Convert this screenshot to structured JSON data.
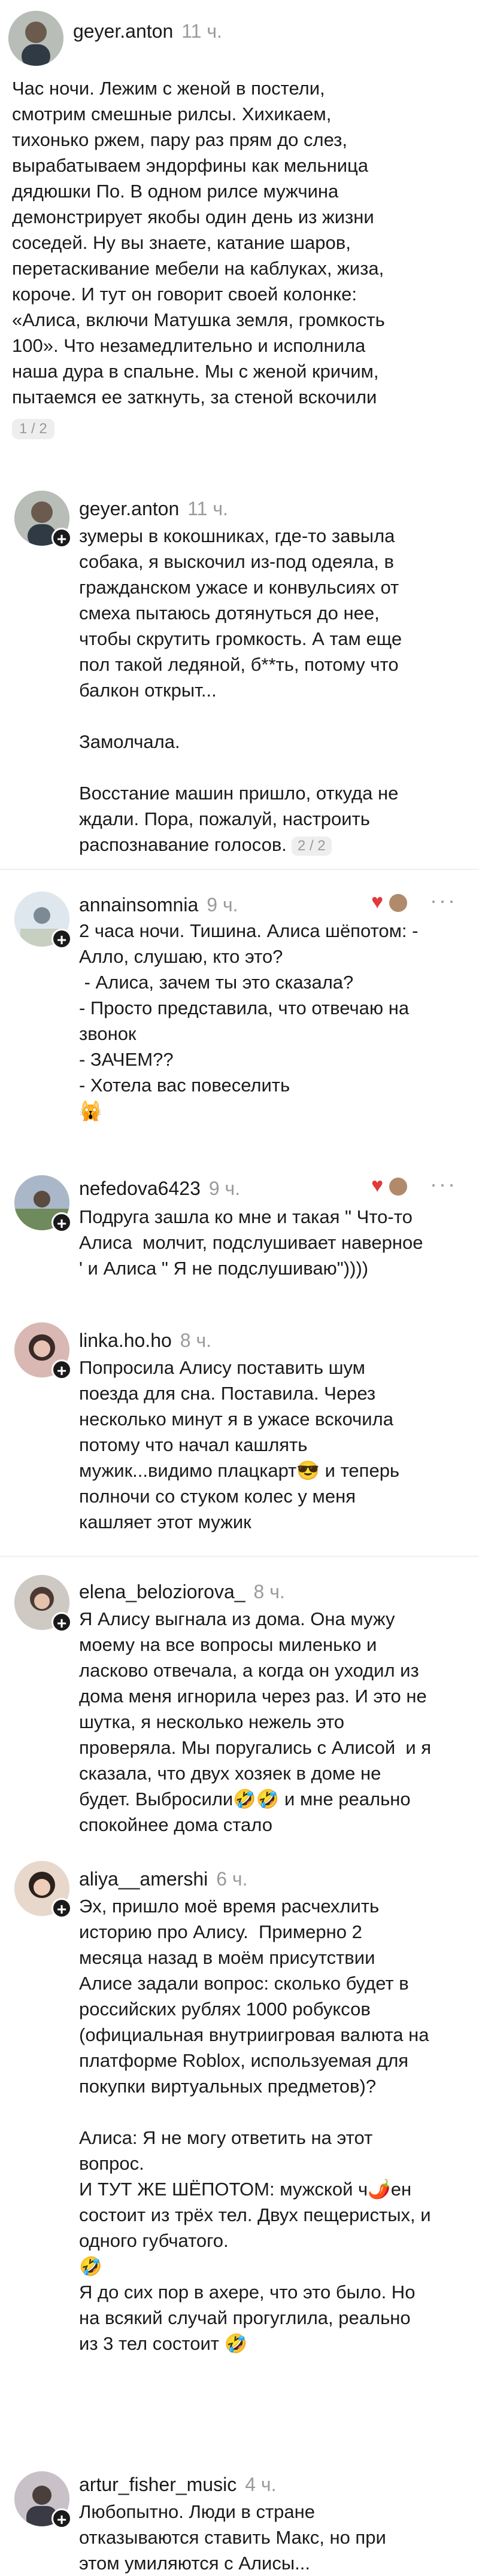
{
  "comments": [
    {
      "username": "geyer.anton",
      "time": "11 ч.",
      "text": "Час ночи. Лежим с женой в постели,\nсмотрим смешные рилсы. Хихикаем,\nтихонько ржем, пару раз прям до слез,\nвырабатываем эндорфины как мельница\nдядюшки По. В одном рилсе мужчина\nдемонстрирует якобы один день из жизни\nсоседей. Ну вы знаете, катание шаров,\nперетаскивание мебели на каблуках, жиза,\nкороче. И тут он говорит своей колонке:\n«Алиса, включи Матушка земля, громкость\n100». Что незамедлительно и исполнила\nнаша дура в спальне. Мы с женой кричим,\nпытаемся ее заткнуть, за стеной вскочили",
      "pager": "1 / 2"
    },
    {
      "username": "geyer.anton",
      "time": "11 ч.",
      "text": "зумеры в кокошниках, где-то завыла\nсобака, я выскочил из-под одеяла, в\nгражданском ужасе и конвульсиях от\nсмеха пытаюсь дотянуться до нее,\nчтобы скрутить громкость. А там еще\nпол такой ледяной, б**ть, потому что\nбалкон открыт...\n\nЗамолчала.\n\nВосстание машин пришло, откуда не\nждали. Пора, пожалуй, настроить\nраспознавание голосов.",
      "pager": "2 / 2"
    },
    {
      "username": "annainsomnia",
      "time": "9 ч.",
      "text": "2 часа ночи. Тишина. Алиса шёпотом: -\nАлло, слушаю, кто это?\n - Алиса, зачем ты это сказала?\n- Просто представила, что отвечаю на\nзвонок\n- ЗАЧЕМ??\n- Хотела вас повеселить\n🙀"
    },
    {
      "username": "nefedova6423",
      "time": "9 ч.",
      "text": "Подруга зашла ко мне и такая \" Что-то\nАлиса  молчит, подслушивает наверное\n' и Алиса \" Я не подслушиваю\"))))"
    },
    {
      "username": "linka.ho.ho",
      "time": "8 ч.",
      "text": "Попросила Алису поставить шум\nпоезда для сна. Поставила. Через\nнесколько минут я в ужасе вскочила\nпотому что начал кашлять\nмужик...видимо плацкарт😎 и теперь\nполночи со стуком колес у меня\nкашляет этот мужик"
    },
    {
      "username": "elena_beloziorova_",
      "time": "8 ч.",
      "text": "Я Алису выгнала из дома. Она мужу\nмоему на все вопросы миленько и\nласково отвечала, а когда он уходил из\nдома меня игнорила через раз. И это не\nшутка, я несколько нежель это\nпроверяла. Мы поругались с Алисой  и я\nсказала, что двух хозяек в доме не\nбудет. Выбросили🤣🤣 и мне реально\nспокойнее дома стало"
    },
    {
      "username": "aliya__amershi",
      "time": "6 ч.",
      "text": "Эх, пришло моё время расчехлить\nисторию про Алису.  Примерно 2\nмесяца назад в моём присутствии\nАлисе задали вопрос: сколько будет в\nроссийских рублях 1000 робуксов\n(официальная внутриигровая валюта на\nплатформе Roblox, используемая для\nпокупки виртуальных предметов)?\n\nАлиса: Я не могу ответить на этот\nвопрос.\nИ ТУТ ЖЕ ШЁПОТОМ: мужской ч🌶️ен\nсостоит из трёх тел. Двух пещеристых, и\nодного губчатого.\n🤣\nЯ до сих пор в ахере, что это было. Но\nна всякий случай прогуглила, реально\nиз 3 тел состоит 🤣"
    },
    {
      "username": "artur_fisher_music",
      "time": "4 ч.",
      "text": "Любопытно. Люди в стране\nотказываются ставить Макс, но при\nэтом умиляются с Алисы..."
    }
  ],
  "colors": {
    "like": "#e03a3a",
    "plus_badge": "#1a1a1a"
  },
  "icons": {
    "more": "more-dots-icon",
    "like": "heart-icon",
    "follow": "plus-icon"
  }
}
